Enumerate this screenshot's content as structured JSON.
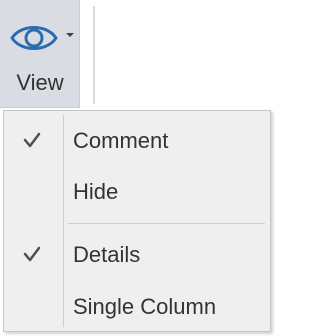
{
  "ribbon": {
    "view_button": {
      "label": "View",
      "icon": "eye-icon",
      "dropdown_icon": "chevron-down-icon",
      "state": "pressed"
    }
  },
  "menu": {
    "groups": [
      {
        "items": [
          {
            "label": "Comment",
            "checked": true
          },
          {
            "label": "Hide",
            "checked": false
          }
        ]
      },
      {
        "items": [
          {
            "label": "Details",
            "checked": true
          },
          {
            "label": "Single Column",
            "checked": false
          }
        ]
      }
    ]
  },
  "colors": {
    "accent": "#2b6cb0",
    "pressed_bg": "#d9dde3",
    "menu_bg": "#efefef",
    "text": "#333333",
    "check": "#505050"
  }
}
